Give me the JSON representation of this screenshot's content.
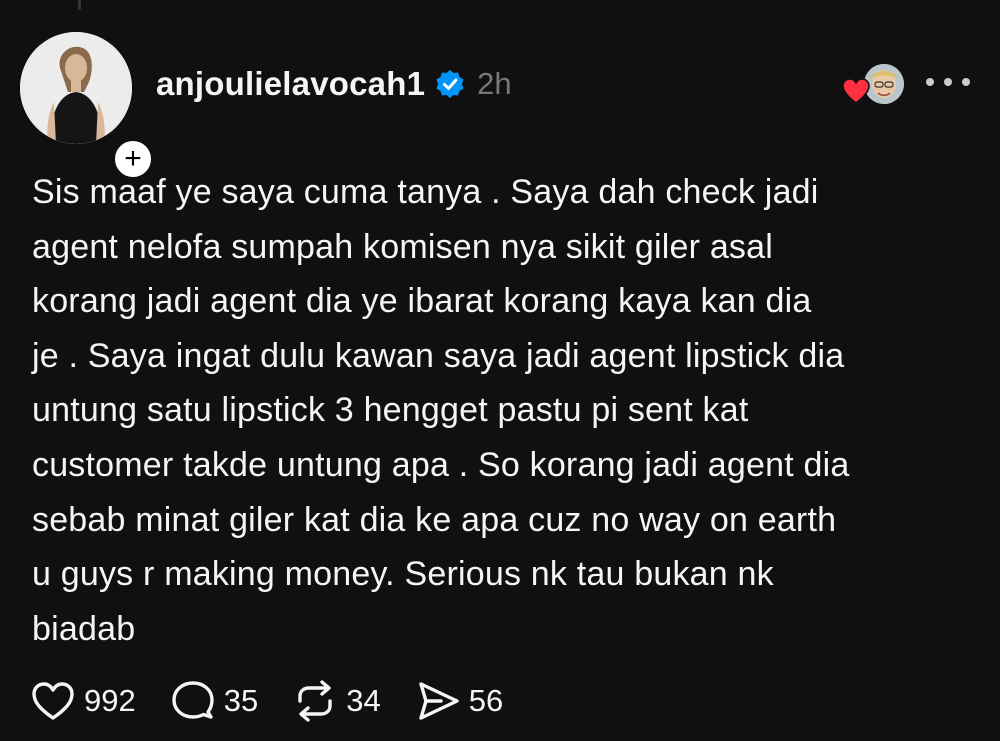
{
  "post": {
    "author": {
      "username": "anjoulielavocah1",
      "verified": true,
      "follow_symbol": "+",
      "avatar_icon": "avatar-photo"
    },
    "timestamp": "2h",
    "text_lines": [
      "Sis maaf ye saya cuma tanya . Saya dah check jadi",
      "agent nelofa sumpah komisen nya sikit giler asal",
      "korang jadi agent dia ye ibarat korang kaya kan dia",
      "je . Saya ingat dulu kawan saya jadi agent lipstick dia",
      "untung satu lipstick 3 hengget pastu pi sent kat",
      "customer takde untung apa . So korang jadi agent dia",
      "sebab minat giler kat dia ke apa cuz no way on earth",
      "u guys r making money. Serious nk tau bukan nk",
      "biadab"
    ]
  },
  "actions": {
    "likes": "992",
    "replies": "35",
    "reposts": "34",
    "shares": "56"
  },
  "colors": {
    "background": "#101010",
    "text": "#f3f5f7",
    "muted": "#777777",
    "verified": "#0095f6",
    "heart": "#ff3040"
  }
}
